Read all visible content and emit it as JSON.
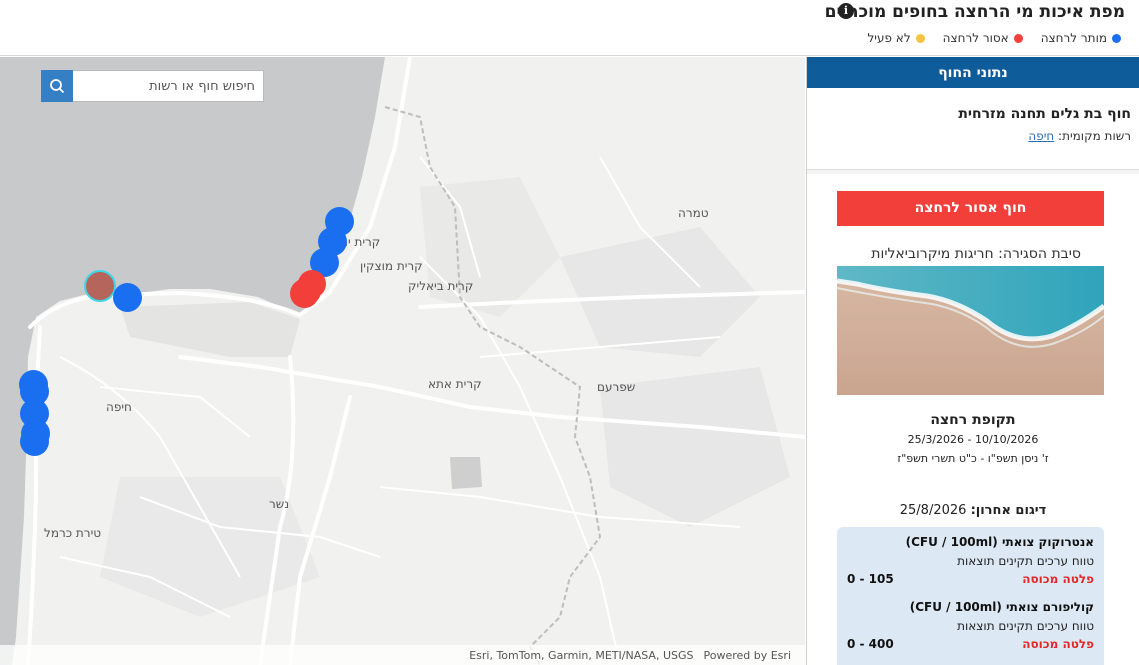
{
  "header": {
    "title": "מפת איכות מי הרחצה בחופים מוכרזים",
    "info_icon": "i",
    "legend": [
      {
        "label": "מותר לרחצה",
        "color": "#1a6ff0"
      },
      {
        "label": "אסור לרחצה",
        "color": "#f23f3a"
      },
      {
        "label": "לא פעיל",
        "color": "#f5c242"
      }
    ]
  },
  "map": {
    "search_placeholder": "חיפוש חוף או רשות",
    "labels": {
      "tamra": "טמרה",
      "kiryat_yam": "קרית ים",
      "kiryat_motzkin": "קרית מוצקין",
      "kiryat_bialik": "קרית ביאליק",
      "kiryat_ata": "קרית אתא",
      "shfaram": "שפרעם",
      "haifa": "חיפה",
      "nesher": "נשר",
      "tirat_carmel": "טירת כרמל"
    },
    "attribution": "Esri, TomTom, Garmin, METI/NASA, USGS",
    "powered_by": "Powered by Esri",
    "water_color": "#c7c9cb",
    "land_color": "#f1f1f0",
    "marker_colors": {
      "allowed": "#1a6ff0",
      "forbidden": "#f23f3a",
      "selected": "#b5655c",
      "selected_ring": "#3fd7e6"
    }
  },
  "panel": {
    "header": "נתוני החוף",
    "beach_name": "חוף בת גלים תחנה מזרחית",
    "authority_label": "רשות מקומית:",
    "authority_value": "חיפה",
    "status": "חוף אסור לרחצה",
    "closure_reason": "סיבת הסגירה: חריגות מיקרוביאליות",
    "season_title": "תקופת רחצה",
    "season_dates": "25/3/2026 - 10/10/2026",
    "season_hebrew": "ז' ניסן תשפ\"ו - כ\"ט תשרי תשפ\"ז",
    "last_sample_label": "דיגום אחרון:",
    "last_sample_date": "25/8/2026",
    "results": [
      {
        "title": "אנטרוקוק צואתי (CFU / 100ml)",
        "range_label": "טווח ערכים תקינים תוצאות",
        "range": "0 - 105",
        "value": "פלטה מכוסה"
      },
      {
        "title": "קוליפורם צואתי (CFU / 100ml)",
        "range_label": "טווח ערכים תקינים תוצאות",
        "range": "0 - 400",
        "value": "פלטה מכוסה"
      }
    ]
  }
}
